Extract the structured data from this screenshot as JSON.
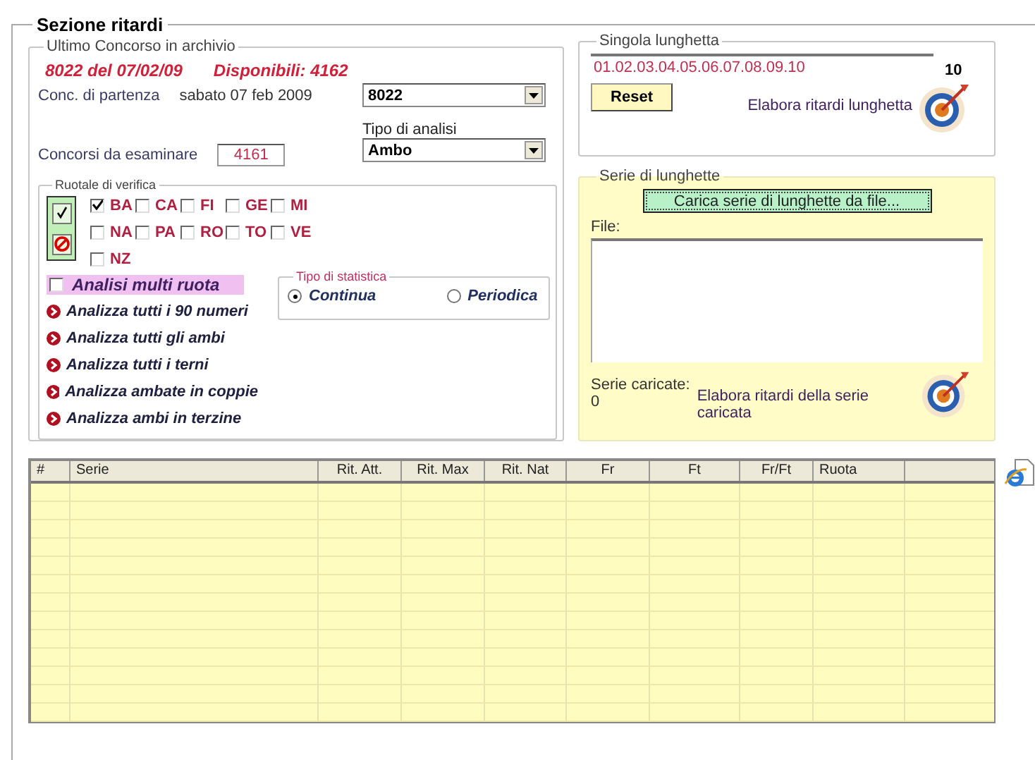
{
  "section": {
    "title": "Sezione ritardi"
  },
  "ultimo": {
    "title": "Ultimo Concorso in archivio",
    "concorso": "8022 del 07/02/09",
    "disponibili": "Disponibili: 4162",
    "partenza_label": "Conc. di partenza",
    "partenza_date": "sabato 07 feb 2009",
    "partenza_select": "8022",
    "tipo_label": "Tipo di analisi",
    "tipo_select": "Ambo",
    "esaminare_label": "Concorsi da esaminare",
    "esaminare_value": "4161"
  },
  "ruotale": {
    "title": "Ruotale di verifica",
    "wheels": [
      {
        "label": "BA",
        "checked": true
      },
      {
        "label": "CA",
        "checked": false
      },
      {
        "label": "FI",
        "checked": false
      },
      {
        "label": "GE",
        "checked": false
      },
      {
        "label": "MI",
        "checked": false
      },
      {
        "label": "NA",
        "checked": false
      },
      {
        "label": "PA",
        "checked": false
      },
      {
        "label": "RO",
        "checked": false
      },
      {
        "label": "TO",
        "checked": false
      },
      {
        "label": "VE",
        "checked": false
      },
      {
        "label": "NZ",
        "checked": false
      }
    ],
    "multi": {
      "label": "Analisi multi ruota",
      "checked": false
    },
    "statistica": {
      "title": "Tipo di statistica",
      "options": [
        {
          "label": "Continua",
          "selected": true
        },
        {
          "label": "Periodica",
          "selected": false
        }
      ]
    },
    "actions": [
      "Analizza tutti i 90 numeri",
      "Analizza tutti gli ambi",
      "Analizza tutti i terni",
      "Analizza ambate in coppie",
      "Analizza ambi in terzine"
    ]
  },
  "singola": {
    "title": "Singola lunghetta",
    "value": "01.02.03.04.05.06.07.08.09.10",
    "count": "10",
    "reset": "Reset",
    "elabora": "Elabora ritardi lunghetta"
  },
  "serie": {
    "title": "Serie di lunghette",
    "load": "Carica serie di lunghette da file...",
    "file_label": "File:",
    "loaded": "Serie caricate: 0",
    "elabora": "Elabora ritardi della serie caricata"
  },
  "table": {
    "columns": [
      "#",
      "Serie",
      "Rit. Att.",
      "Rit. Max",
      "Rit. Nat",
      "Fr",
      "Ft",
      "Fr/Ft",
      "Ruota"
    ]
  }
}
